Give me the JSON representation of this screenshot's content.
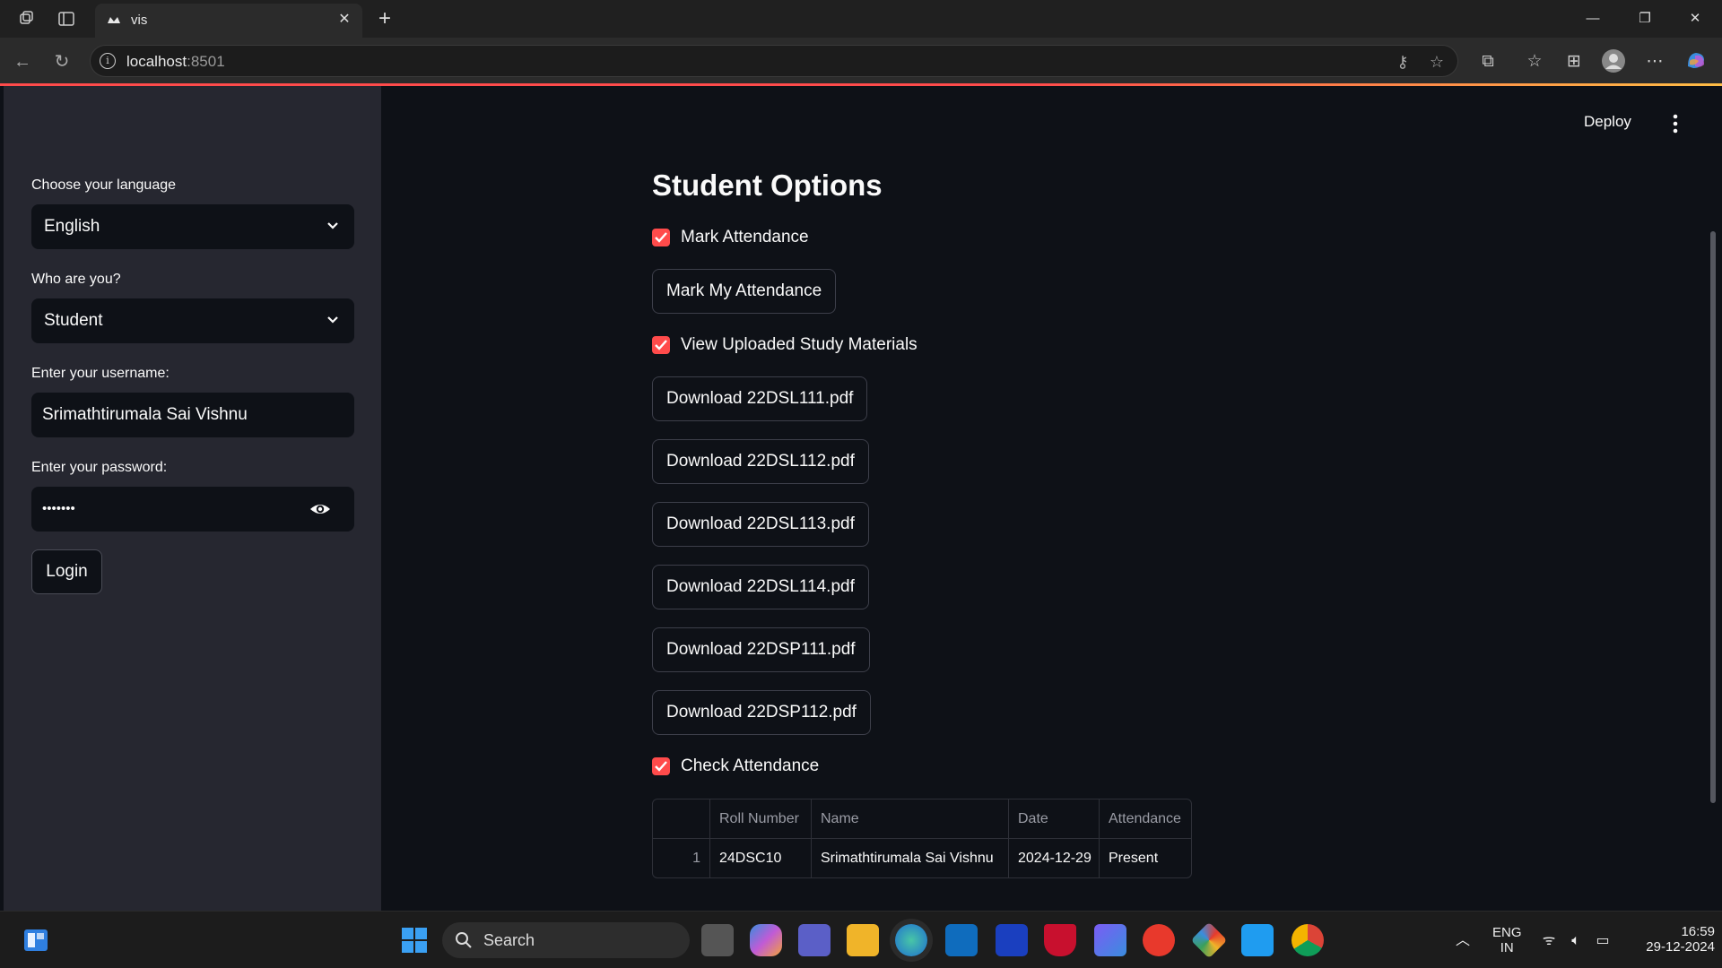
{
  "browser": {
    "tab_title": "vis",
    "url_host": "localhost",
    "url_port": ":8501",
    "new_tab_glyph": "+",
    "close_glyph": "✕"
  },
  "sidebar": {
    "language_label": "Choose your language",
    "language_value": "English",
    "role_label": "Who are you?",
    "role_value": "Student",
    "username_label": "Enter your username:",
    "username_value": "Srimathtirumala Sai Vishnu",
    "password_label": "Enter your password:",
    "password_value": "•••••••",
    "login_label": "Login"
  },
  "header": {
    "deploy_label": "Deploy"
  },
  "main": {
    "title": "Student Options",
    "mark_attendance": {
      "label": "Mark Attendance",
      "checked": true
    },
    "mark_button": "Mark My Attendance",
    "view_materials": {
      "label": "View Uploaded Study Materials",
      "checked": true
    },
    "downloads": [
      "Download 22DSL111.pdf",
      "Download 22DSL112.pdf",
      "Download 22DSL113.pdf",
      "Download 22DSL114.pdf",
      "Download 22DSP111.pdf",
      "Download 22DSP112.pdf"
    ],
    "check_attendance": {
      "label": "Check Attendance",
      "checked": true
    },
    "table": {
      "columns": [
        "",
        "Roll Number",
        "Name",
        "Date",
        "Attendance"
      ],
      "rows": [
        [
          "1",
          "24DSC10",
          "Srimathtirumala Sai Vishnu",
          "2024-12-29",
          "Present"
        ]
      ]
    }
  },
  "taskbar": {
    "search_label": "Search",
    "lang_line1": "ENG",
    "lang_line2": "IN",
    "time": "16:59",
    "date": "29-12-2024"
  },
  "colors": {
    "accent": "#ff4b4b",
    "sidebar_bg": "#262730",
    "main_bg": "#0e1117"
  }
}
